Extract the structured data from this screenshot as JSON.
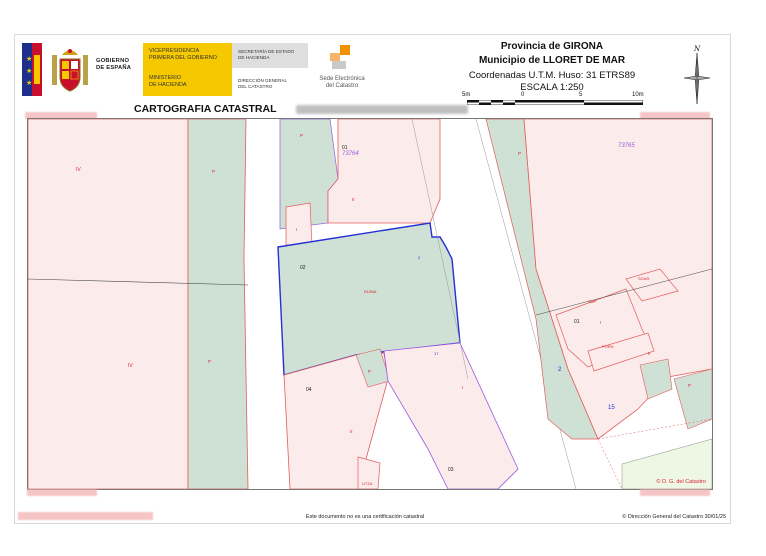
{
  "header": {
    "gov_lines": [
      "GOBIERNO",
      "DE ESPAÑA"
    ],
    "vice_lines": [
      "VICEPRESIDENCIA",
      "PRIMERA DEL GOBIERNO"
    ],
    "min_lines": [
      "MINISTERIO",
      "DE HACIENDA"
    ],
    "sec_lines": [
      "SECRETARÍA DE ESTADO",
      "DE HACIENDA"
    ],
    "dir_lines": [
      "DIRECCIÓN GENERAL",
      "DEL CATASTRO"
    ],
    "sede_lines": [
      "Sede Electrónica",
      "del Catastro"
    ],
    "provincia": "Provincia de GIRONA",
    "municipio": "Municipio de LLORET DE MAR",
    "coordenadas": "Coordenadas U.T.M. Huso: 31 ETRS89",
    "escala": "ESCALA 1:250",
    "scale_labels": [
      "5m",
      "0",
      "5",
      "10m"
    ],
    "compass_label": "N",
    "cartografia": "CARTOGRAFIA CATASTRAL"
  },
  "map": {
    "parcel_labels": {
      "p73764": "73764",
      "p73765": "73765",
      "p01a": "01",
      "p02": "02",
      "p03": "03",
      "p04": "04",
      "p01b": "01"
    },
    "use_labels": {
      "iv_top": "IV",
      "iv_bottom": "IV",
      "p1": "P",
      "p2": "P",
      "p3": "P",
      "p4": "P",
      "p5": "P",
      "p6": "P",
      "ii1": "II",
      "ii2": "II",
      "ii3": "II",
      "i1": "I",
      "i2": "I",
      "i3": "I",
      "ruina": "RUINA",
      "sup": "SUP",
      "sgar": "SGAR",
      "porh": "PORH",
      "utza": "UTZA"
    },
    "street_numbers": {
      "n2": "2",
      "n15": "15",
      "n_small1": "2",
      "n_small2": "17"
    },
    "credit": "© D. G. del Catastro"
  },
  "footer": {
    "disclaimer": "Este documento no es una certificación catastral",
    "copyright": "© Dirección General del Catastro 30/01/25"
  },
  "colors": {
    "parcel_pink": "#fbeceb",
    "parcel_green": "#cfe0d5",
    "parcel_line_red": "#e35c5c",
    "parcel_line_blue": "#2430d6",
    "label_purple": "#9a58e0"
  }
}
